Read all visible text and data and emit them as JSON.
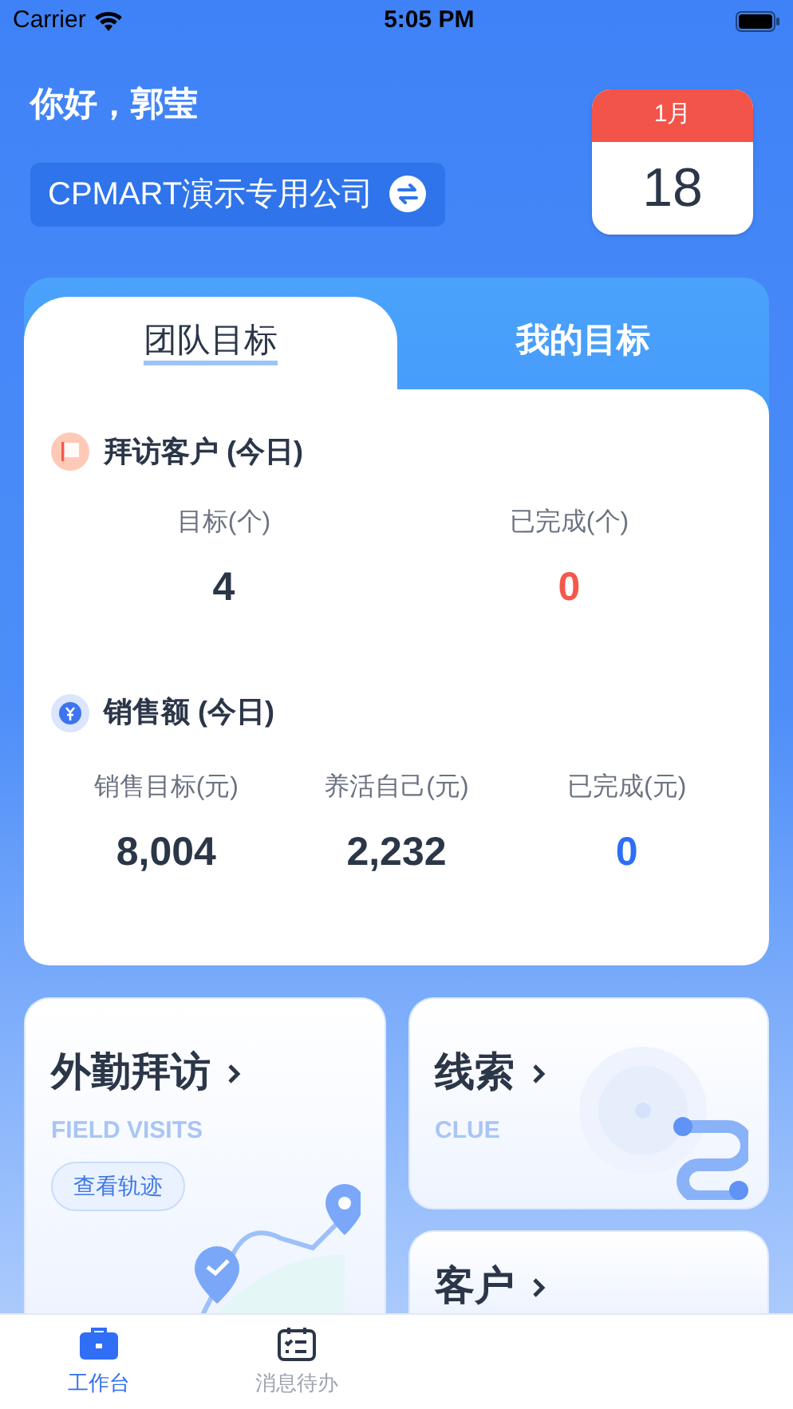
{
  "status_bar": {
    "carrier": "Carrier",
    "time": "5:05 PM"
  },
  "greeting": "你好，郭莹",
  "company": {
    "name": "CPMART演示专用公司"
  },
  "calendar": {
    "month": "1月",
    "day": "18"
  },
  "goal_tabs": [
    {
      "label": "团队目标",
      "selected": true
    },
    {
      "label": "我的目标",
      "selected": false
    }
  ],
  "sections": [
    {
      "kind": "visits",
      "title": "拜访客户 (今日)",
      "metrics": [
        {
          "label": "目标(个)",
          "value": "4",
          "color": "#2b3648"
        },
        {
          "label": "已完成(个)",
          "value": "0",
          "color": "#f5574c"
        }
      ]
    },
    {
      "kind": "sales",
      "title": "销售额 (今日)",
      "metrics": [
        {
          "label": "销售目标(元)",
          "value": "8,004",
          "color": "#2b3648"
        },
        {
          "label": "养活自己(元)",
          "value": "2,232",
          "color": "#2b3648"
        },
        {
          "label": "已完成(元)",
          "value": "0",
          "color": "#2f6ef5"
        }
      ]
    }
  ],
  "shortcuts": [
    {
      "kind": "map",
      "title": "外勤拜访",
      "subtitle": "FIELD VISITS",
      "button": "查看轨迹"
    },
    {
      "kind": "target",
      "title": "线索",
      "subtitle": "CLUE"
    },
    {
      "kind": "plain",
      "title": "客户"
    }
  ],
  "tab_bar": [
    {
      "kind": "briefcase",
      "label": "工作台",
      "selected": true
    },
    {
      "kind": "calendar",
      "label": "消息待办",
      "selected": false
    }
  ]
}
